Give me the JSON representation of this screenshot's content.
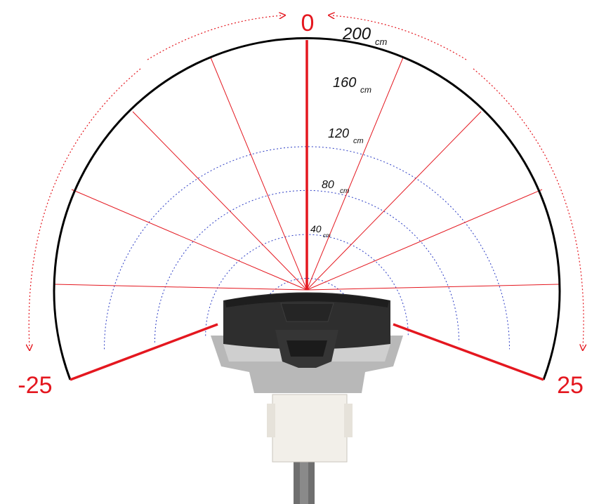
{
  "diagram": {
    "direction_labels": {
      "center": "0",
      "left": "-25",
      "right": "25"
    },
    "range_rings": [
      {
        "value": "40",
        "unit": "cm"
      },
      {
        "value": "80",
        "unit": "cm"
      },
      {
        "value": "120",
        "unit": "cm"
      },
      {
        "value": "160",
        "unit": "cm"
      },
      {
        "value": "200",
        "unit": "cm"
      }
    ],
    "colors": {
      "beam": "#e4171f",
      "ring": "#2b3cc4",
      "outer_arc": "#000000",
      "sensor_body": "#2e2e2e",
      "sensor_base": "#b8b8b8",
      "connector": "#f2efe9"
    }
  }
}
